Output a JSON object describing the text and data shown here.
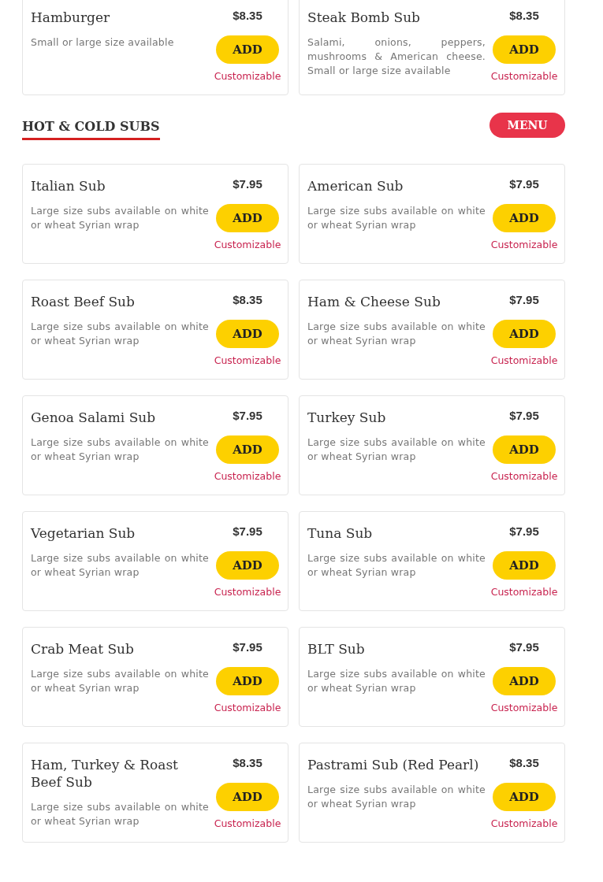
{
  "previous_items": [
    {
      "name": "Hamburger",
      "price": "$8.35",
      "description": "Small or large size available",
      "button": "ADD",
      "note": "Customizable"
    },
    {
      "name": "Steak Bomb Sub",
      "price": "$8.35",
      "description": "Salami, onions, peppers, mushrooms & American cheese. Small or large size available",
      "button": "ADD",
      "note": "Customizable"
    }
  ],
  "section": {
    "title": "HOT & COLD SUBS",
    "menu_button": "MENU",
    "items": [
      {
        "name": "Italian Sub",
        "price": "$7.95",
        "description": "Large size subs available on white or wheat Syrian wrap",
        "button": "ADD",
        "note": "Customizable"
      },
      {
        "name": "American Sub",
        "price": "$7.95",
        "description": "Large size subs available on white or wheat Syrian wrap",
        "button": "ADD",
        "note": "Customizable"
      },
      {
        "name": "Roast Beef Sub",
        "price": "$8.35",
        "description": "Large size subs available on white or wheat Syrian wrap",
        "button": "ADD",
        "note": "Customizable"
      },
      {
        "name": "Ham & Cheese Sub",
        "price": "$7.95",
        "description": "Large size subs available on white or wheat Syrian wrap",
        "button": "ADD",
        "note": "Customizable"
      },
      {
        "name": "Genoa Salami Sub",
        "price": "$7.95",
        "description": "Large size subs available on white or wheat Syrian wrap",
        "button": "ADD",
        "note": "Customizable"
      },
      {
        "name": "Turkey Sub",
        "price": "$7.95",
        "description": "Large size subs available on white or wheat Syrian wrap",
        "button": "ADD",
        "note": "Customizable"
      },
      {
        "name": "Vegetarian Sub",
        "price": "$7.95",
        "description": "Large size subs available on white or wheat Syrian wrap",
        "button": "ADD",
        "note": "Customizable"
      },
      {
        "name": "Tuna Sub",
        "price": "$7.95",
        "description": "Large size subs available on white or wheat Syrian wrap",
        "button": "ADD",
        "note": "Customizable"
      },
      {
        "name": "Crab Meat Sub",
        "price": "$7.95",
        "description": "Large size subs available on white or wheat Syrian wrap",
        "button": "ADD",
        "note": "Customizable"
      },
      {
        "name": "BLT Sub",
        "price": "$7.95",
        "description": "Large size subs available on white or wheat Syrian wrap",
        "button": "ADD",
        "note": "Customizable"
      },
      {
        "name": "Ham, Turkey & Roast Beef Sub",
        "price": "$8.35",
        "description": "Large size subs available on white or wheat Syrian wrap",
        "button": "ADD",
        "note": "Customizable"
      },
      {
        "name": "Pastrami Sub (Red Pearl)",
        "price": "$8.35",
        "description": "Large size subs available on white or wheat Syrian wrap",
        "button": "ADD",
        "note": "Customizable"
      }
    ]
  }
}
